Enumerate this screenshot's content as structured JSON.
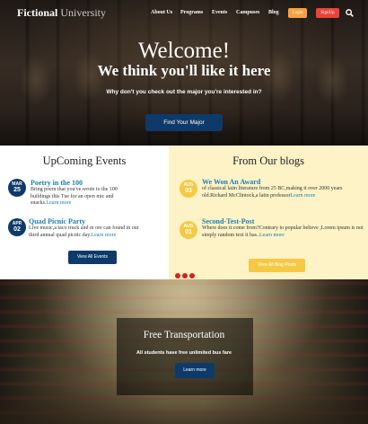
{
  "header": {
    "logo_main": "Fictional",
    "logo_sub": "University",
    "nav": [
      "About Us",
      "Programs",
      "Events",
      "Campuses",
      "Blog"
    ],
    "login_label": "Login",
    "signup_label": "SignUp",
    "search_icon": "search-icon"
  },
  "hero": {
    "title": "Welcome!",
    "subtitle": "We think you'll like it here",
    "question": "Why don't you check out the major you're interested in?",
    "button_label": "Find Your Major"
  },
  "events": {
    "heading": "UpComing Events",
    "items": [
      {
        "month": "MAR",
        "day": "25",
        "title": "Poetry in the 100",
        "text": "Bring poem that you've wrote to the 100 buildings this Tue for an open mic and snacks.",
        "more": "Learn more"
      },
      {
        "month": "APR",
        "day": "02",
        "title": "Quad Picnic Party",
        "text": "Live music,a taco truck and m ore can found in our third annual quad picnic day.",
        "more": "Learn more"
      }
    ],
    "button_label": "View All Events",
    "accent_color": "#0e3a6a"
  },
  "blogs": {
    "heading": "From Our blogs",
    "items": [
      {
        "month": "AUG",
        "day": "03",
        "title": "We Won An Award",
        "text": "of classical latin literature from 25 BC,making it over 2000 years old.Richard McClintock,a latin professor",
        "more": "Learn more"
      },
      {
        "month": "AUG",
        "day": "01",
        "title": "Second-Test-Post",
        "text": "Where does it come from?Contrary to popular believe ,Lorem ipsum is not simply random text it has..",
        "more": "Learn more"
      }
    ],
    "button_label": "View All Blog Posts",
    "accent_color": "#f5c944"
  },
  "carousel": {
    "dots": 3,
    "color": "#d42121"
  },
  "transport": {
    "title": "Free Transportation",
    "subtitle": "All students have free unlimited bus fare",
    "button_label": "Learn more"
  }
}
